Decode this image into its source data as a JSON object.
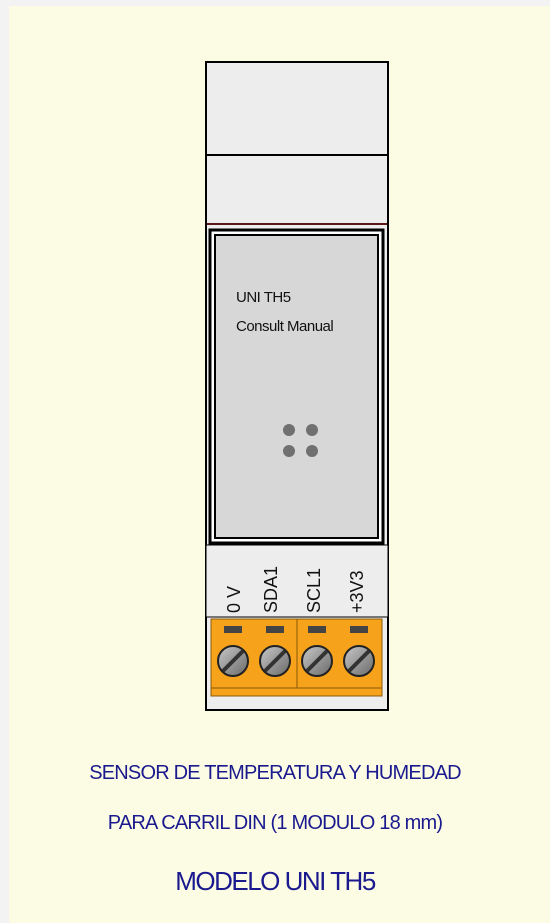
{
  "device": {
    "label_line1": "UNI TH5",
    "label_line2": "Consult Manual",
    "terminals": [
      "0 V",
      "SDA1",
      "SCL1",
      "+3V3"
    ],
    "colors": {
      "housing": "#ededed",
      "front_panel": "#d7d7d7",
      "terminal_block": "#f7a21b",
      "sensor_dots": "#707070"
    }
  },
  "caption": {
    "line1": "SENSOR DE TEMPERATURA Y HUMEDAD",
    "line2": "PARA CARRIL DIN (1 MODULO 18 mm)",
    "model": "MODELO UNI TH5",
    "color": "#1a1a8e"
  }
}
